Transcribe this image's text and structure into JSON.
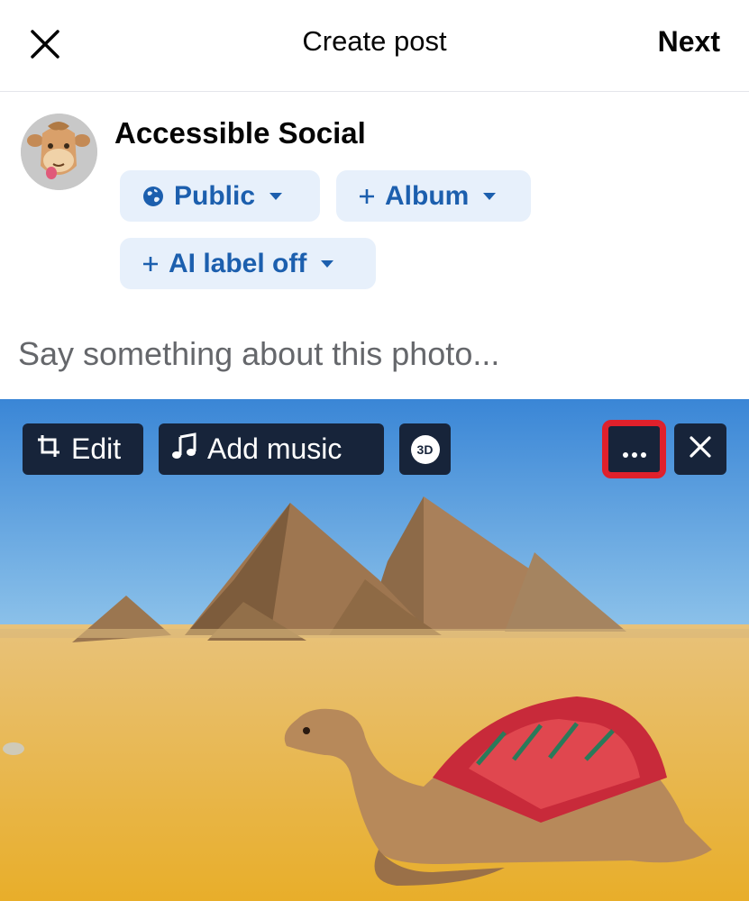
{
  "header": {
    "title": "Create post",
    "next_label": "Next",
    "close_icon": "close-icon"
  },
  "author": {
    "name": "Accessible Social",
    "avatar": "camel-avatar"
  },
  "pills": {
    "privacy": "Public",
    "album": "Album",
    "ai_label": "AI label off"
  },
  "composer": {
    "placeholder": "Say something about this photo..."
  },
  "photo_toolbar": {
    "edit_label": "Edit",
    "music_label": "Add music",
    "three_d_label": "3D"
  },
  "colors": {
    "accent_text": "#1c5fae",
    "pill_bg": "#e7f0fb",
    "toolbar_bg": "#17243a",
    "highlight": "#e0202b"
  }
}
